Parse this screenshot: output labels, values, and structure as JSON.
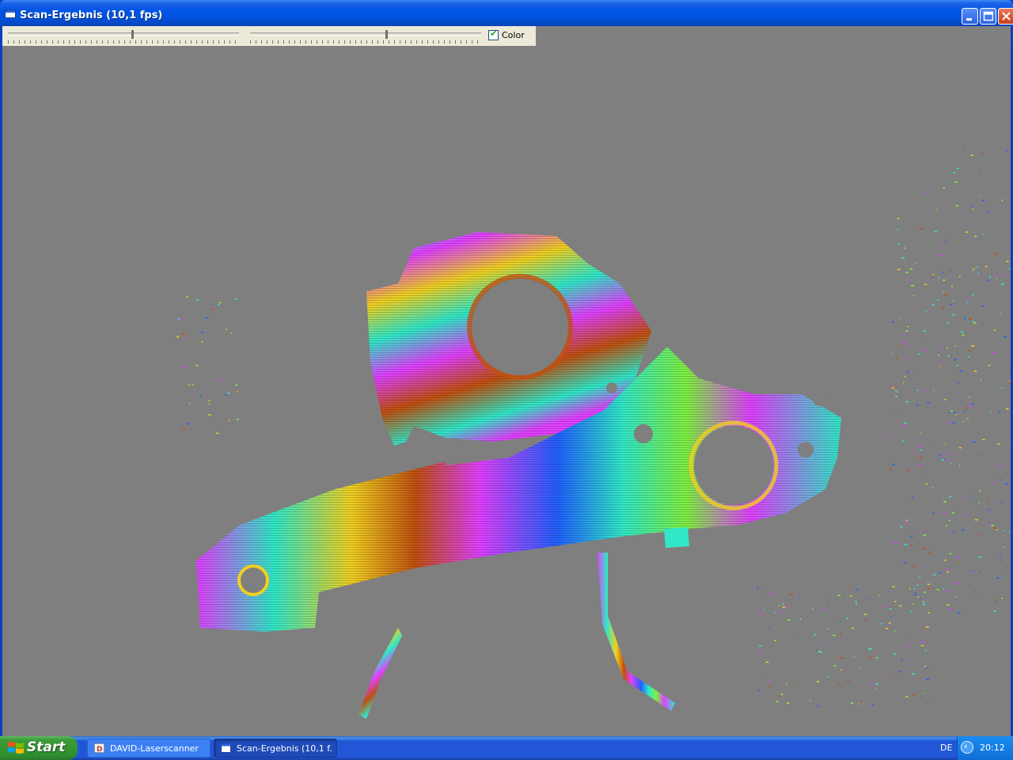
{
  "window": {
    "title": "Scan-Ergebnis (10,1 fps)",
    "controls": [
      "minimize-icon",
      "maximize-icon",
      "close-icon"
    ]
  },
  "toolbar": {
    "slider1": {
      "value_fraction": 0.54
    },
    "slider2": {
      "value_fraction": 0.59
    },
    "color_checkbox": {
      "label": "Color",
      "checked": true
    }
  },
  "viewport": {
    "content": "3D scan point cloud rendered with rainbow depth coloring",
    "background_color": "#7f7f7f",
    "palette": [
      "#e040ff",
      "#30e8c8",
      "#f0d020",
      "#c05010",
      "#2060ff",
      "#80f040"
    ]
  },
  "taskbar": {
    "start_label": "Start",
    "tasks": [
      {
        "label": "DAVID-Laserscanner",
        "active": false
      },
      {
        "label": "Scan-Ergebnis (10,1 f...",
        "active": true
      }
    ],
    "tray": {
      "language": "DE",
      "time": "20:12"
    }
  }
}
